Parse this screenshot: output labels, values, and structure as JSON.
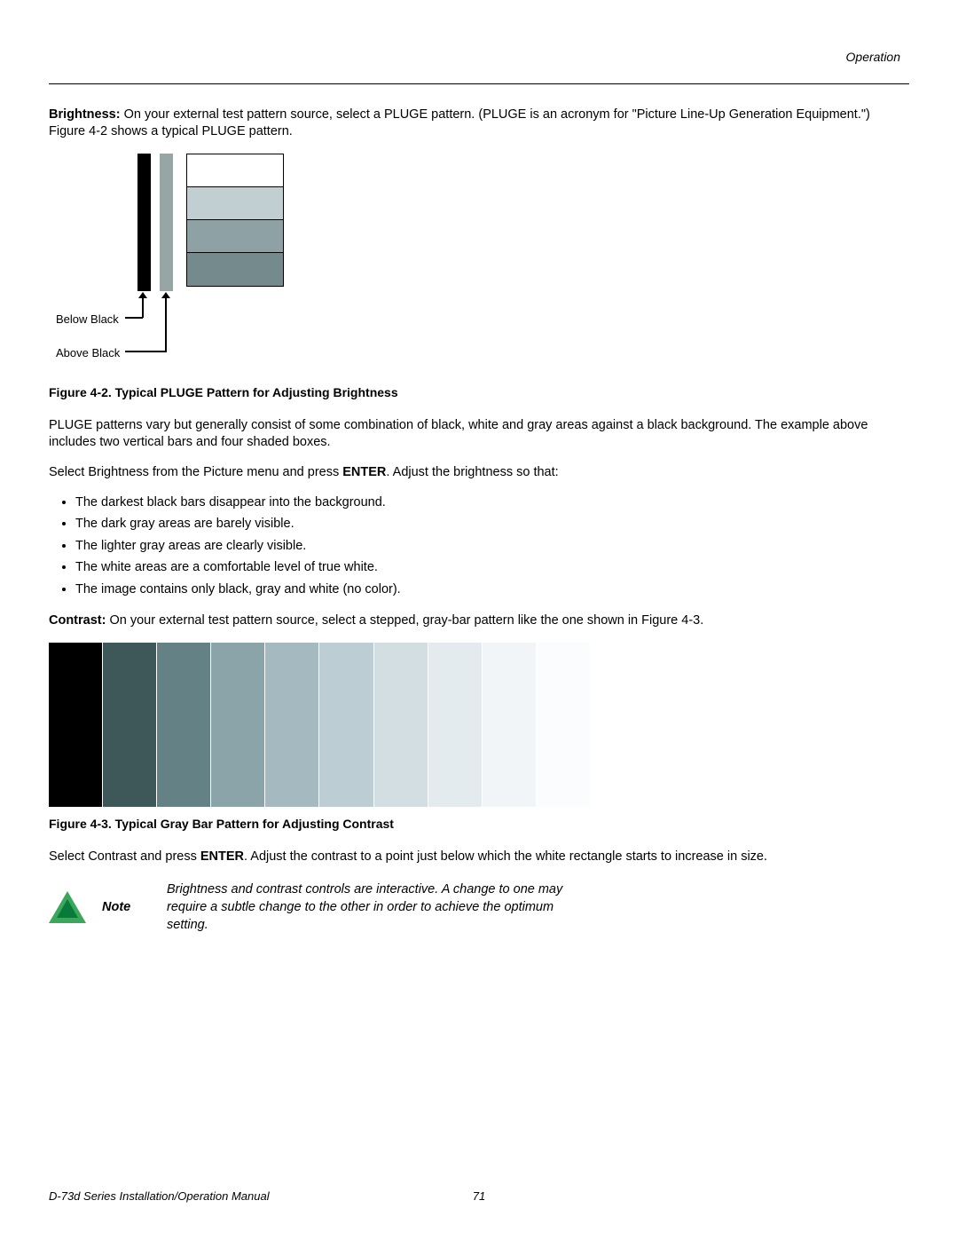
{
  "header": {
    "section": "Operation"
  },
  "brightness": {
    "lead_bold": "Brightness:",
    "lead_text": " On your external test pattern source, select a PLUGE pattern. (PLUGE is an acronym for \"Picture Line-Up Generation Equipment.\") Figure 4-2 shows a typical PLUGE pattern."
  },
  "pluge": {
    "below_label": "Below Black",
    "above_label": "Above Black",
    "caption": "Figure 4-2. Typical PLUGE Pattern for Adjusting Brightness",
    "box_colors": [
      "#ffffff",
      "#c1cfd3",
      "#8ea1a4",
      "#758a8c"
    ]
  },
  "para_after_fig42": "PLUGE patterns vary but generally consist of some combination of black, white and gray areas against a black background. The example above includes two vertical bars and four shaded boxes.",
  "select_brightness": {
    "pre": "Select Brightness from the Picture menu and press ",
    "bold": "ENTER",
    "post": ". Adjust the brightness so that:"
  },
  "bullets": [
    "The darkest black bars disappear into the background.",
    "The dark gray areas are barely visible.",
    "The lighter gray areas are clearly visible.",
    "The white areas are a comfortable level of true white.",
    "The image contains only black, gray and white (no color)."
  ],
  "contrast": {
    "lead_bold": "Contrast:",
    "lead_text": " On your external test pattern source, select a stepped, gray-bar pattern like the one shown in Figure 4-3."
  },
  "graybar_colors": [
    "#000000",
    "#3e5759",
    "#648186",
    "#8aa4aa",
    "#a4bac0",
    "#bccdd3",
    "#d3dee3",
    "#e4ebee",
    "#f1f5f7",
    "#fbfcfd"
  ],
  "fig43_caption": "Figure 4-3. Typical Gray Bar Pattern for Adjusting Contrast",
  "select_contrast": {
    "pre": "Select Contrast and press ",
    "bold": "ENTER",
    "post": ". Adjust the contrast to a point just below which the white rectangle starts to increase in size."
  },
  "note": {
    "label": "Note",
    "text": "Brightness and contrast controls are interactive. A change to one may require a subtle change to the other in order to achieve the optimum setting."
  },
  "footer": {
    "manual": "D-73d Series Installation/Operation Manual",
    "page": "71"
  }
}
